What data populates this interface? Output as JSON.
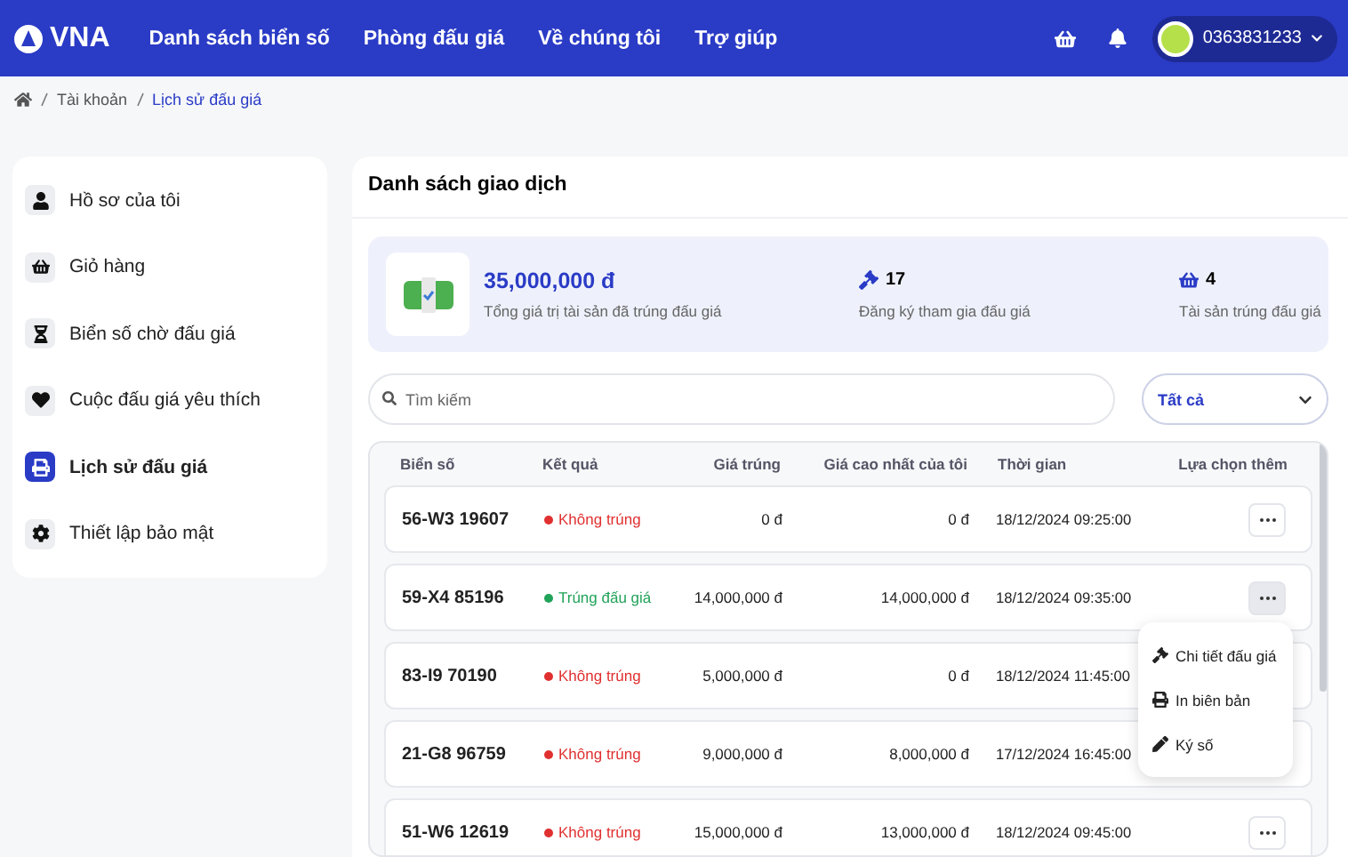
{
  "nav": {
    "logo": "VNA",
    "links": [
      "Danh sách biển số",
      "Phòng đấu giá",
      "Về chúng tôi",
      "Trợ giúp"
    ],
    "phone": "0363831233"
  },
  "breadcrumb": [
    "Tài khoản",
    "Lịch sử đấu giá"
  ],
  "sidebar": {
    "items": [
      {
        "label": "Hồ sơ của tôi",
        "selected": false
      },
      {
        "label": "Giỏ hàng",
        "selected": false
      },
      {
        "label": "Biển số chờ đấu giá",
        "selected": false
      },
      {
        "label": "Cuộc đấu giá yêu thích",
        "selected": false
      },
      {
        "label": "Lịch sử đấu giá",
        "selected": true
      },
      {
        "label": "Thiết lập bảo mật",
        "selected": false
      }
    ]
  },
  "main": {
    "title": "Danh sách giao dịch",
    "summary": {
      "total": "35,000,000 đ",
      "total_label": "Tổng giá trị tài sản đã trúng đấu giá",
      "registered": "17",
      "registered_label": "Đăng ký tham gia đấu giá",
      "won": "4",
      "won_label": "Tài sản trúng đấu giá"
    },
    "search": {
      "placeholder": "Tìm kiếm"
    },
    "filter": "Tất cả",
    "table": {
      "columns": [
        "Biển số",
        "Kết quả",
        "Giá trúng",
        "Giá cao nhất của tôi",
        "Thời gian",
        "Lựa chọn thêm"
      ],
      "rows": [
        {
          "plate": "56-W3 19607",
          "result": "Không trúng",
          "won": false,
          "price": "0 đ",
          "my_max": "0 đ",
          "time": "18/12/2024 09:25:00",
          "menu_open": false
        },
        {
          "plate": "59-X4 85196",
          "result": "Trúng đấu giá",
          "won": true,
          "price": "14,000,000 đ",
          "my_max": "14,000,000 đ",
          "time": "18/12/2024 09:35:00",
          "menu_open": true
        },
        {
          "plate": "83-I9 70190",
          "result": "Không trúng",
          "won": false,
          "price": "5,000,000 đ",
          "my_max": "0 đ",
          "time": "18/12/2024 11:45:00",
          "menu_open": false
        },
        {
          "plate": "21-G8 96759",
          "result": "Không trúng",
          "won": false,
          "price": "9,000,000 đ",
          "my_max": "8,000,000 đ",
          "time": "17/12/2024 16:45:00",
          "menu_open": false
        },
        {
          "plate": "51-W6 12619",
          "result": "Không trúng",
          "won": false,
          "price": "15,000,000 đ",
          "my_max": "13,000,000 đ",
          "time": "18/12/2024 09:45:00",
          "menu_open": false
        }
      ]
    },
    "menu": [
      {
        "label": "Chi tiết đấu giá"
      },
      {
        "label": "In biên bản"
      },
      {
        "label": "Ký số"
      }
    ]
  }
}
